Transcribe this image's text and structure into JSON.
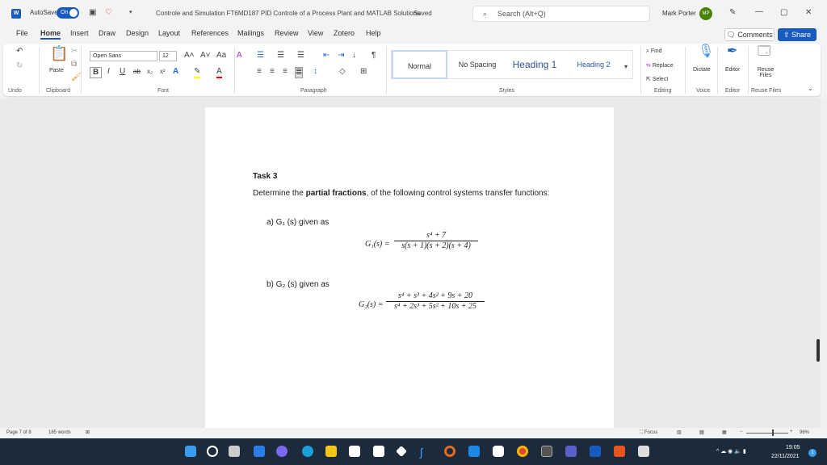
{
  "titlebar": {
    "autosave_label": "AutoSave",
    "autosave_state": "On",
    "doc_title": "Controle and Simulation FT6MD187 PID Controle of a Process Plant and MATLAB Solutions",
    "saved_status": "Saved",
    "search_placeholder": "Search (Alt+Q)",
    "user_name": "Mark Porter",
    "user_initials": "MP"
  },
  "menu_tabs": [
    "File",
    "Home",
    "Insert",
    "Draw",
    "Design",
    "Layout",
    "References",
    "Mailings",
    "Review",
    "View",
    "Zotero",
    "Help"
  ],
  "active_tab": "Home",
  "header_buttons": {
    "comments": "Comments",
    "share": "Share"
  },
  "ribbon": {
    "groups": [
      "Undo",
      "Clipboard",
      "Font",
      "Paragraph",
      "Styles",
      "Editing",
      "Voice",
      "Editor",
      "Reuse Files"
    ],
    "paste": "Paste",
    "font_name": "Open Sans",
    "font_size": "12",
    "styles": [
      "Normal",
      "No Spacing",
      "Heading 1",
      "Heading 2"
    ],
    "editing": [
      "Find",
      "Replace",
      "Select"
    ],
    "dictate": "Dictate",
    "editor": "Editor",
    "reuse_files": "Reuse Files",
    "accent": "#185abd"
  },
  "document": {
    "heading": "Task 3",
    "intro_pre": "Determine the ",
    "intro_bold": "partial fractions",
    "intro_post": ", of the following control systems transfer functions:",
    "item_a": "a)  G₁ (s) given as",
    "eq_a_lhs": "G₁(s) =",
    "eq_a_num": "s⁴ + 7",
    "eq_a_den": "s(s + 1)(s + 2)(s + 4)",
    "item_b": "b)  G₂ (s) given as",
    "eq_b_lhs": "G₂(s) =",
    "eq_b_num": "s⁴ + s³ + 4s² + 9s + 20",
    "eq_b_den": "s⁴ + 2s³ + 5s² + 10s + 25"
  },
  "status": {
    "page": "Page 7 of 8",
    "words": "185 words",
    "focus": "Focus",
    "zoom": "96%",
    "zoom_level_percent": 96
  },
  "taskbar": {
    "time": "19:05",
    "date": "22/11/2021",
    "notifications": "1"
  }
}
